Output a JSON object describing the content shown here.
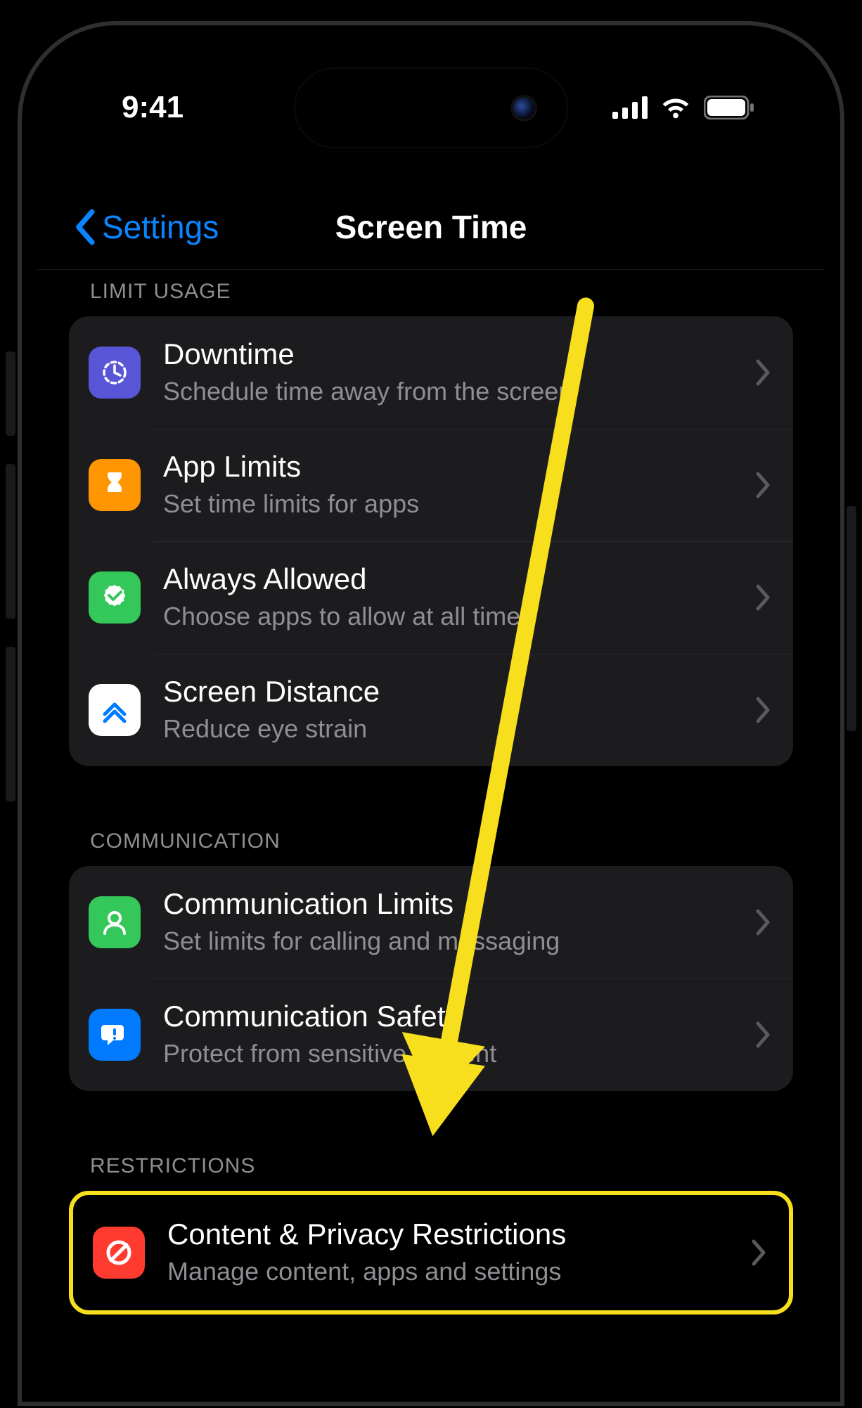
{
  "status": {
    "time": "9:41"
  },
  "nav": {
    "back_label": "Settings",
    "title": "Screen Time"
  },
  "sections": {
    "limit_usage": {
      "header": "LIMIT USAGE",
      "items": {
        "downtime": {
          "title": "Downtime",
          "subtitle": "Schedule time away from the screen"
        },
        "app_limits": {
          "title": "App Limits",
          "subtitle": "Set time limits for apps"
        },
        "always_allowed": {
          "title": "Always Allowed",
          "subtitle": "Choose apps to allow at all times"
        },
        "screen_distance": {
          "title": "Screen Distance",
          "subtitle": "Reduce eye strain"
        }
      }
    },
    "communication": {
      "header": "COMMUNICATION",
      "items": {
        "comm_limits": {
          "title": "Communication Limits",
          "subtitle": "Set limits for calling and messaging"
        },
        "comm_safety": {
          "title": "Communication Safety",
          "subtitle": "Protect from sensitive content"
        }
      }
    },
    "restrictions": {
      "header": "RESTRICTIONS",
      "items": {
        "content_privacy": {
          "title": "Content & Privacy Restrictions",
          "subtitle": "Manage content, apps and settings"
        }
      }
    }
  },
  "annotation": {
    "highlight_color": "#f7df1e"
  }
}
